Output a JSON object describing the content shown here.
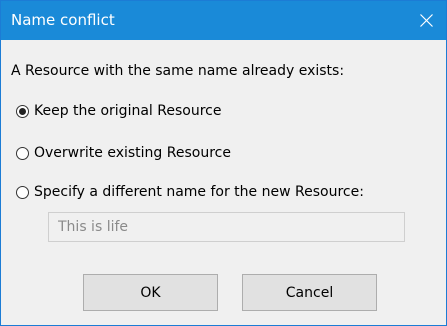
{
  "window": {
    "title": "Name conflict",
    "close_icon": "close-icon"
  },
  "dialog": {
    "prompt": "A Resource with the same name already exists:",
    "options": [
      {
        "label": "Keep the original Resource",
        "checked": true
      },
      {
        "label": "Overwrite existing Resource",
        "checked": false
      },
      {
        "label": "Specify a different name for the new Resource:",
        "checked": false
      }
    ],
    "new_name": {
      "value": "This is life",
      "disabled": true
    },
    "buttons": {
      "ok_label": "OK",
      "cancel_label": "Cancel"
    }
  },
  "colors": {
    "titlebar": "#1a8ad8",
    "window_border": "#1c7cd5",
    "dialog_background": "#f0f0f0",
    "button_background": "#e1e1e1"
  }
}
